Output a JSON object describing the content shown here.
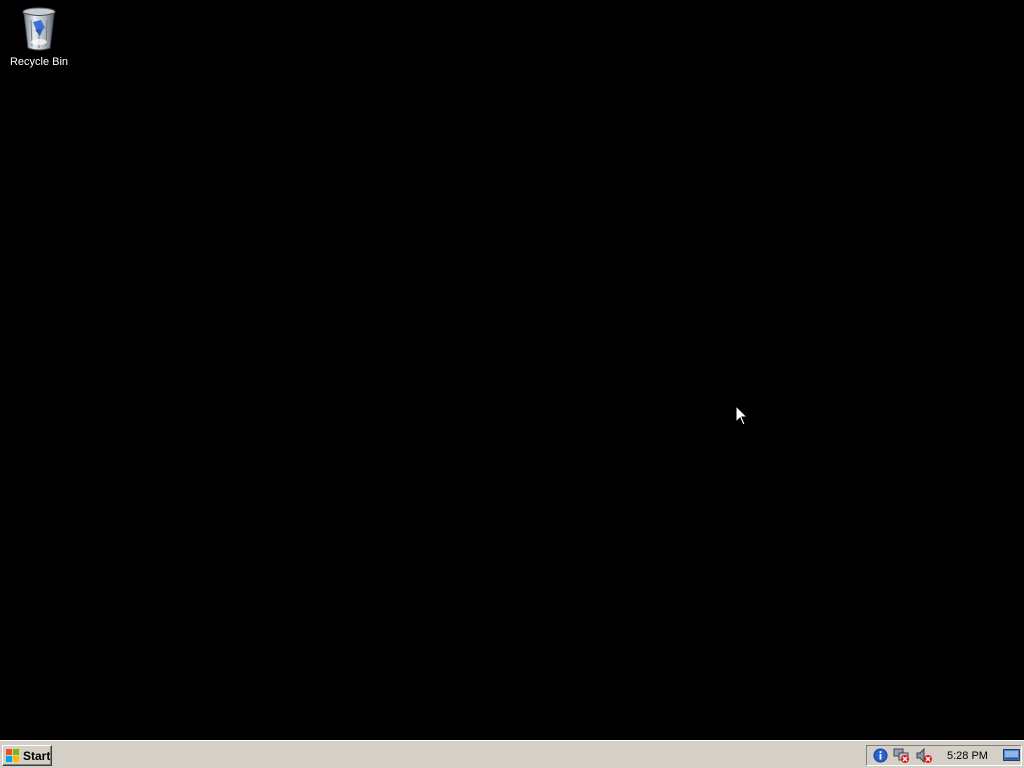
{
  "desktop": {
    "background_color": "#000000",
    "icons": [
      {
        "label": "Recycle Bin",
        "icon": "recycle-bin-icon"
      }
    ]
  },
  "taskbar": {
    "start_label": "Start",
    "start_icon": "windows-logo-icon",
    "tray": {
      "icons": [
        "info-icon",
        "network-disconnected-icon",
        "volume-muted-icon"
      ],
      "clock": "5:28 PM",
      "show_desktop_icon": "show-desktop-icon"
    }
  }
}
